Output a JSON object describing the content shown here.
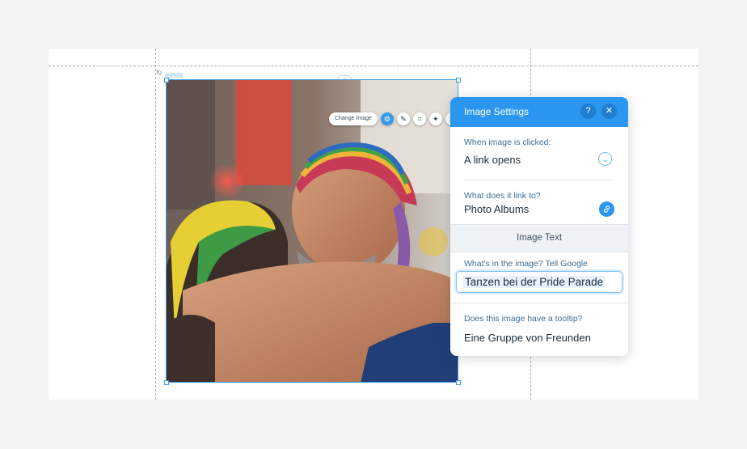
{
  "image_toolbar": {
    "change_image_label": "Change Image",
    "tools": [
      {
        "name": "settings-gear-icon",
        "active": true
      },
      {
        "name": "pencil-icon",
        "active": false
      },
      {
        "name": "crop-icon",
        "active": false
      },
      {
        "name": "magic-wand-icon",
        "active": false
      },
      {
        "name": "animation-icon",
        "active": false
      }
    ]
  },
  "panel": {
    "title": "Image Settings",
    "help_label": "?",
    "close_label": "✕",
    "click_action": {
      "label": "When image is clicked:",
      "value": "A link opens"
    },
    "link_target": {
      "label": "What does it link to?",
      "value": "Photo Albums"
    },
    "image_text_header": "Image Text",
    "alt_text": {
      "label": "What's in the image? Tell Google",
      "value": "Tanzen bei der Pride Parade"
    },
    "tooltip": {
      "label": "Does this image have a tooltip?",
      "value": "Eine Gruppe von Freunden"
    }
  },
  "colors": {
    "accent": "#2b96ef",
    "selection": "#3899ec",
    "label": "#3b6d96"
  }
}
